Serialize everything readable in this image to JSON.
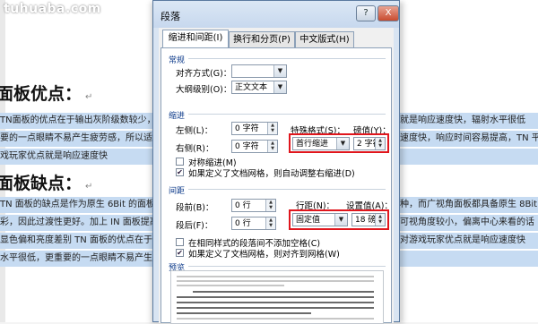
{
  "watermark": "tuhuaba.com",
  "document": {
    "heading1": "面板优点：",
    "heading2": "面板缺点：",
    "return_mark": "↵",
    "lines_left": [
      "TN面板的优点在于输出灰阶级数较少，液",
      "要的一点眼睛不易产生疲劳感，所以适合",
      "戏玩家优点就是响应速度快"
    ],
    "lines_left2": [
      "TN 面板的缺点是作为原生 6Bit 的面板，",
      "彩，因此过渡性更好。加上 IN 面板提高",
      "显色偏和亮度差别 TN 面板的优点在于输出",
      "水平很低，更重要的一点眼睛不易产生疲"
    ],
    "lines_right": [
      "就是响应速度快，辐射水平很低",
      "速度快，响应时间容易提高，TN 平",
      ""
    ],
    "lines_right2": [
      "种，而广视角面板都具备原生 8Bit",
      "可视角度较小，偏离中心来看的话",
      "对游戏玩家优点就是响应速度快",
      ""
    ]
  },
  "dialog": {
    "title": "段落",
    "help_button": "?",
    "close_button": "X",
    "tabs": [
      "缩进和间距(I)",
      "换行和分页(P)",
      "中文版式(H)"
    ],
    "general": {
      "section": "常规",
      "alignment_label": "对齐方式(G)：",
      "alignment_value": "",
      "outline_label": "大纲级别(O)：",
      "outline_value": "正文文本"
    },
    "indent": {
      "section": "缩进",
      "left_label": "左侧(L)：",
      "left_value": "0 字符",
      "right_label": "右侧(R)：",
      "right_value": "0 字符",
      "special_label": "特殊格式(S)：",
      "special_value": "首行缩进",
      "measure_label": "磅值(Y)：",
      "measure_value": "2 字符",
      "mirror_label": "对称缩进(M)",
      "auto_adjust_label": "如果定义了文档网格，则自动调整右缩进(D)"
    },
    "spacing": {
      "section": "间距",
      "before_label": "段前(B)：",
      "before_value": "0 行",
      "after_label": "段后(F)：",
      "after_value": "0 行",
      "line_spacing_label": "行距(N)：",
      "line_spacing_value": "固定值",
      "at_label": "设置值(A)：",
      "at_value": "18 磅",
      "no_space_label": "在相同样式的段落间不添加空格(C)",
      "snap_grid_label": "如果定义了文档网格，则对齐到网格(W)"
    },
    "preview": {
      "section": "预览"
    }
  },
  "colors": {
    "highlight": "#c6dbf2",
    "red_box": "#e0161d",
    "section_blue": "#0c3a8a"
  }
}
